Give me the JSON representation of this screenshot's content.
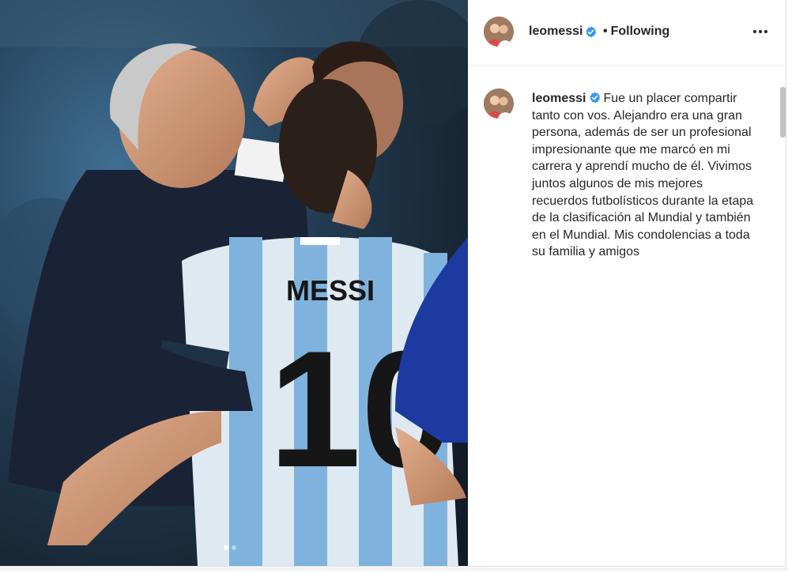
{
  "post": {
    "username": "leomessi",
    "verified_icon": "verified-badge-icon",
    "follow_status": "Following",
    "more_icon": "more-options-icon",
    "photo": {
      "jersey_name": "MESSI",
      "jersey_number": "10",
      "carousel_dots": 2,
      "carousel_active": 0
    },
    "caption": "Fue un placer compartir tanto con vos. Alejandro era una gran persona, además de ser un profesional impresionante que me marcó en mi carrera y aprendí mucho de él. Vivimos juntos algunos de mis mejores recuerdos futbolísticos durante la etapa de la clasificación al Mundial y también en el Mundial. Mis condolencias a toda su familia y amigos"
  },
  "colors": {
    "verified_blue": "#3897f0",
    "text": "#262626",
    "border": "#dbdbdb"
  }
}
